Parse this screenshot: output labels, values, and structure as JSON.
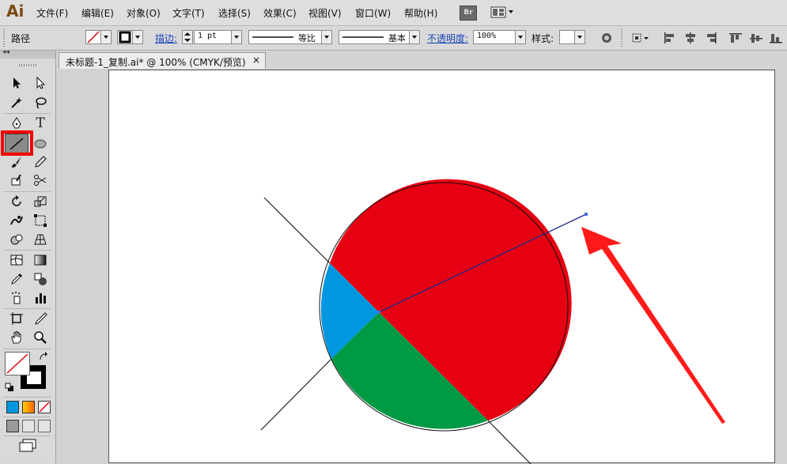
{
  "app": {
    "logo": "Ai"
  },
  "menubar": {
    "items": [
      "文件(F)",
      "编辑(E)",
      "对象(O)",
      "文字(T)",
      "选择(S)",
      "效果(C)",
      "视图(V)",
      "窗口(W)",
      "帮助(H)"
    ],
    "bridge_label": "Br"
  },
  "control_bar": {
    "selection_label": "路径",
    "stroke_label": "描边:",
    "stroke_weight": "1 pt",
    "profile_label": "等比",
    "brush_label": "基本",
    "opacity_label": "不透明度:",
    "opacity_value": "100%",
    "style_label": "样式:"
  },
  "document": {
    "tab_title": "未标题-1_复制.ai* @ 100% (CMYK/预览)",
    "close_glyph": "×"
  },
  "toolbox": {
    "collapse_glyph": "◂◂",
    "active_tool": "line-segment-tool",
    "tools": [
      "selection",
      "direct-selection",
      "magic-wand",
      "lasso",
      "pen",
      "type",
      "line-segment",
      "ellipse",
      "paintbrush",
      "pencil",
      "blob-brush",
      "scissors",
      "rotate",
      "scale",
      "warp",
      "free-transform",
      "shape-builder",
      "graph",
      "mesh",
      "gradient",
      "eyedropper",
      "blend",
      "symbol-sprayer",
      "column-graph",
      "artboard",
      "slice",
      "hand",
      "zoom"
    ]
  },
  "artwork": {
    "pie_colors": {
      "red": "#e60012",
      "blue": "#0097e0",
      "green": "#009a44"
    },
    "guide_line_color": "#1b2a8a",
    "arrow_color": "#ff1a1a"
  }
}
